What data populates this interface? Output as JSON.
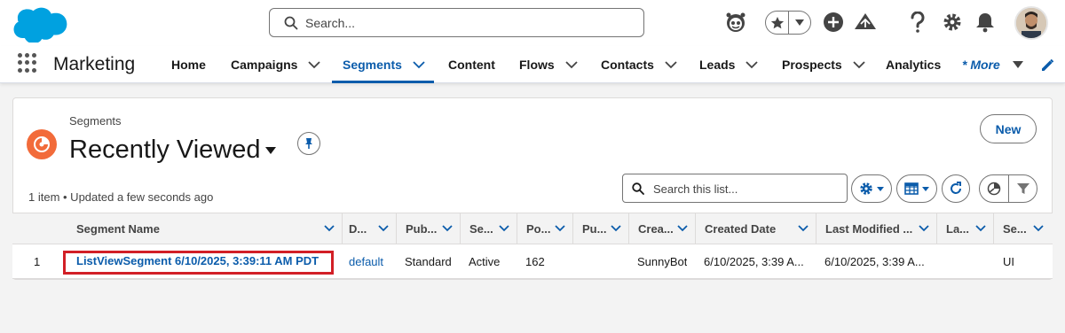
{
  "header": {
    "search_placeholder": "Search...",
    "icons": [
      "salesforce-cloud-logo",
      "einstein-icon",
      "favorites-star-icon",
      "add-icon",
      "trailhead-icon",
      "help-icon",
      "setup-gear-icon",
      "notifications-bell-icon",
      "user-avatar"
    ]
  },
  "nav": {
    "app_name": "Marketing",
    "items": [
      {
        "label": "Home",
        "has_menu": false
      },
      {
        "label": "Campaigns",
        "has_menu": true
      },
      {
        "label": "Segments",
        "has_menu": true,
        "active": true
      },
      {
        "label": "Content",
        "has_menu": false
      },
      {
        "label": "Flows",
        "has_menu": true
      },
      {
        "label": "Contacts",
        "has_menu": true
      },
      {
        "label": "Leads",
        "has_menu": true
      },
      {
        "label": "Prospects",
        "has_menu": true
      },
      {
        "label": "Analytics",
        "has_menu": false
      },
      {
        "label": "* More",
        "has_menu": true
      }
    ]
  },
  "list_view": {
    "object_label": "Segments",
    "title": "Recently Viewed",
    "new_button": "New",
    "status": "1 item • Updated a few seconds ago",
    "search_placeholder": "Search this list..."
  },
  "table": {
    "columns": [
      "Segment Name",
      "D...",
      "Pub...",
      "Se...",
      "Po...",
      "Pu...",
      "Crea...",
      "Created Date",
      "Last Modified ...",
      "La...",
      "Se..."
    ],
    "rows": [
      {
        "num": "1",
        "segment_name": "ListViewSegment 6/10/2025, 3:39:11 AM PDT",
        "d": "default",
        "pub": "Standard",
        "se": "Active",
        "po": "162",
        "pu": "",
        "crea": "SunnyBot",
        "created_date": "6/10/2025, 3:39 A...",
        "last_modified": "6/10/2025, 3:39 A...",
        "la": "",
        "se2": "UI"
      }
    ]
  },
  "colors": {
    "brand_blue": "#0b5cab",
    "logo_blue": "#00a1e0",
    "segment_orange": "#f26b3a",
    "highlight_red": "#d21f26"
  }
}
